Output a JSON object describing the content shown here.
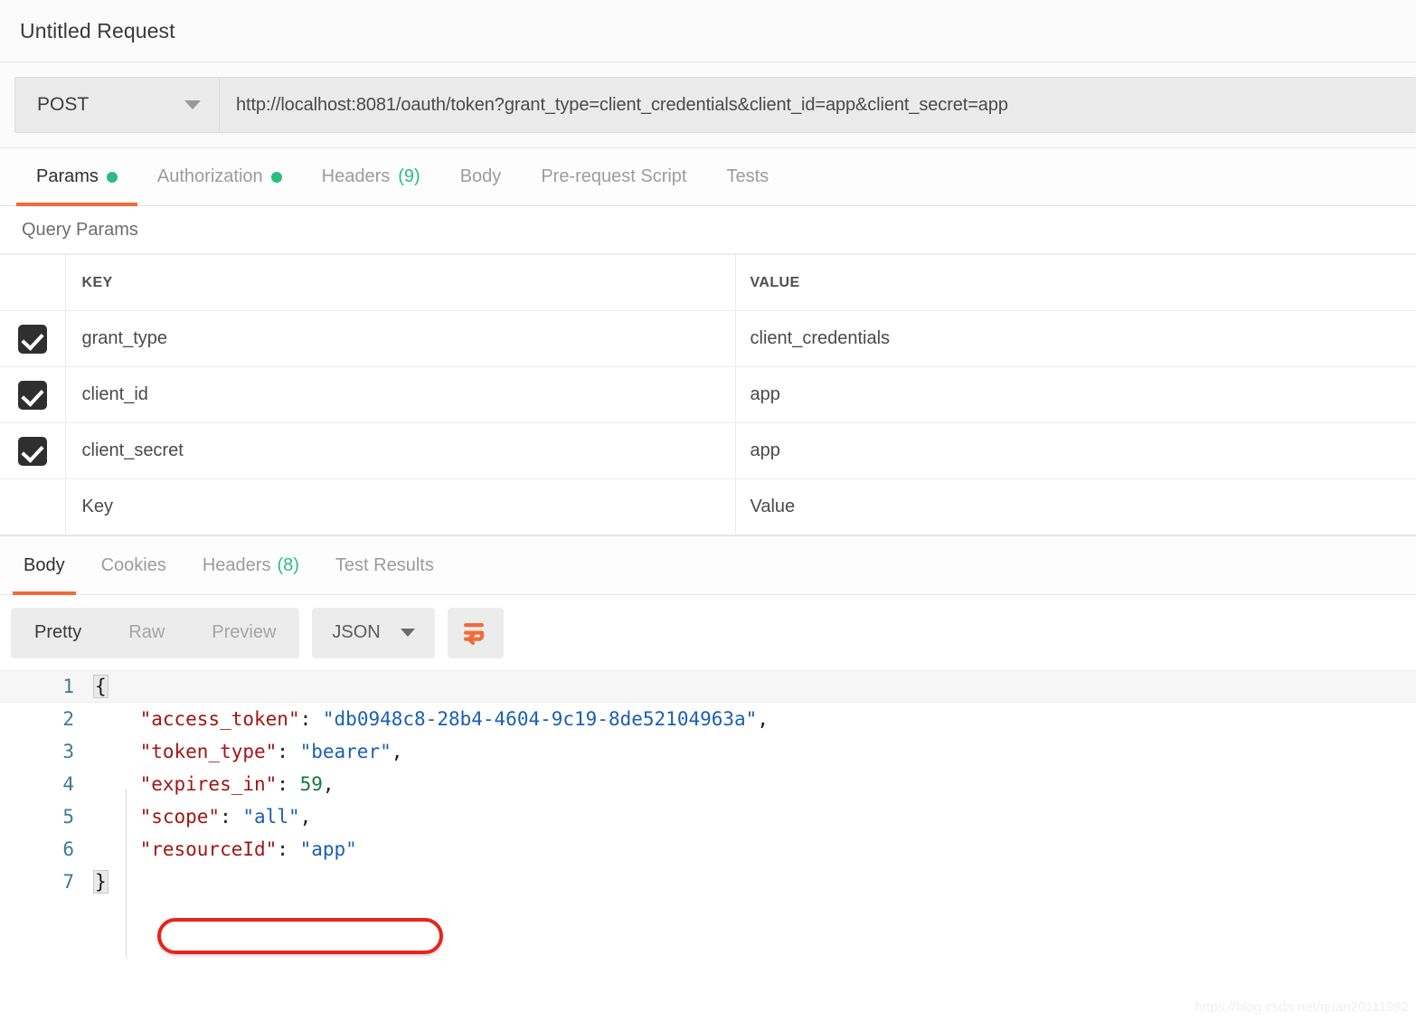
{
  "request": {
    "title": "Untitled Request",
    "method": "POST",
    "url": "http://localhost:8081/oauth/token?grant_type=client_credentials&client_id=app&client_secret=app",
    "tabs": [
      {
        "label": "Params",
        "dot": true,
        "count": "",
        "active": true
      },
      {
        "label": "Authorization",
        "dot": true,
        "count": "",
        "active": false
      },
      {
        "label": "Headers",
        "dot": false,
        "count": "(9)",
        "active": false
      },
      {
        "label": "Body",
        "dot": false,
        "count": "",
        "active": false
      },
      {
        "label": "Pre-request Script",
        "dot": false,
        "count": "",
        "active": false
      },
      {
        "label": "Tests",
        "dot": false,
        "count": "",
        "active": false
      }
    ]
  },
  "query_params": {
    "section_title": "Query Params",
    "headers": {
      "key": "KEY",
      "value": "VALUE"
    },
    "rows": [
      {
        "checked": true,
        "key": "grant_type",
        "value": "client_credentials"
      },
      {
        "checked": true,
        "key": "client_id",
        "value": "app"
      },
      {
        "checked": true,
        "key": "client_secret",
        "value": "app"
      }
    ],
    "new_row": {
      "key_placeholder": "Key",
      "value_placeholder": "Value"
    }
  },
  "response": {
    "tabs": [
      {
        "label": "Body",
        "count": "",
        "active": true
      },
      {
        "label": "Cookies",
        "count": "",
        "active": false
      },
      {
        "label": "Headers",
        "count": "(8)",
        "active": false
      },
      {
        "label": "Test Results",
        "count": "",
        "active": false
      }
    ],
    "view_modes": [
      {
        "label": "Pretty",
        "active": true
      },
      {
        "label": "Raw",
        "active": false
      },
      {
        "label": "Preview",
        "active": false
      }
    ],
    "format": "JSON",
    "wrap_icon": "word-wrap-icon",
    "body_lines": [
      {
        "n": "1",
        "tokens": [
          {
            "t": "{",
            "c": "brace"
          }
        ]
      },
      {
        "n": "2",
        "tokens": [
          {
            "t": "    ",
            "c": "k-pun"
          },
          {
            "t": "\"access_token\"",
            "c": "k-key"
          },
          {
            "t": ": ",
            "c": "k-pun"
          },
          {
            "t": "\"db0948c8-28b4-4604-9c19-8de52104963a\"",
            "c": "k-str"
          },
          {
            "t": ",",
            "c": "k-pun"
          }
        ]
      },
      {
        "n": "3",
        "tokens": [
          {
            "t": "    ",
            "c": "k-pun"
          },
          {
            "t": "\"token_type\"",
            "c": "k-key"
          },
          {
            "t": ": ",
            "c": "k-pun"
          },
          {
            "t": "\"bearer\"",
            "c": "k-str"
          },
          {
            "t": ",",
            "c": "k-pun"
          }
        ]
      },
      {
        "n": "4",
        "tokens": [
          {
            "t": "    ",
            "c": "k-pun"
          },
          {
            "t": "\"expires_in\"",
            "c": "k-key"
          },
          {
            "t": ": ",
            "c": "k-pun"
          },
          {
            "t": "59",
            "c": "k-num"
          },
          {
            "t": ",",
            "c": "k-pun"
          }
        ]
      },
      {
        "n": "5",
        "tokens": [
          {
            "t": "    ",
            "c": "k-pun"
          },
          {
            "t": "\"scope\"",
            "c": "k-key"
          },
          {
            "t": ": ",
            "c": "k-pun"
          },
          {
            "t": "\"all\"",
            "c": "k-str"
          },
          {
            "t": ",",
            "c": "k-pun"
          }
        ]
      },
      {
        "n": "6",
        "tokens": [
          {
            "t": "    ",
            "c": "k-pun"
          },
          {
            "t": "\"resourceId\"",
            "c": "k-key"
          },
          {
            "t": ": ",
            "c": "k-pun"
          },
          {
            "t": "\"app\"",
            "c": "k-str"
          }
        ]
      },
      {
        "n": "7",
        "tokens": [
          {
            "t": "}",
            "c": "brace"
          }
        ]
      }
    ]
  },
  "annotation": {
    "shape": "red-ellipse",
    "color": "#e8241c",
    "targets_line": "6"
  },
  "watermark": "https://blog.csdn.net/quan20111992",
  "colors": {
    "accent_orange": "#f26b3a",
    "dot_green": "#2cbd7e",
    "annotation_red": "#e8241c",
    "json_key": "#a31515",
    "json_string": "#1a5fb4",
    "json_number": "#157a3f"
  }
}
